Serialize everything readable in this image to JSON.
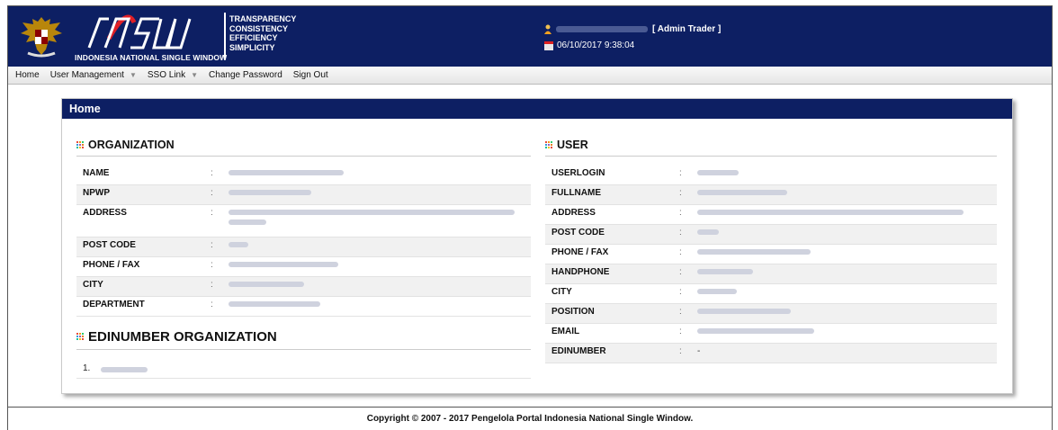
{
  "header": {
    "insw_subtitle": "INDONESIA NATIONAL SINGLE WINDOW",
    "slogan": [
      "TRANSPARENCY",
      "CONSISTENCY",
      "EFFICIENCY",
      "SIMPLICITY"
    ],
    "role": "[ Admin Trader ]",
    "datetime": "06/10/2017 9:38:04",
    "brand_color": "#0d1f63"
  },
  "menu": {
    "items": [
      {
        "label": "Home",
        "has_caret": false
      },
      {
        "label": "User Management",
        "has_caret": true
      },
      {
        "label": "SSO Link",
        "has_caret": true
      },
      {
        "label": "Change Password",
        "has_caret": false
      },
      {
        "label": "Sign Out",
        "has_caret": false
      }
    ]
  },
  "panel": {
    "title": "Home",
    "organization": {
      "title": "ORGANIZATION",
      "fields": [
        {
          "label": "NAME",
          "value": ""
        },
        {
          "label": "NPWP",
          "value": ""
        },
        {
          "label": "ADDRESS",
          "value": ""
        },
        {
          "label": "POST CODE",
          "value": ""
        },
        {
          "label": "PHONE / FAX",
          "value": ""
        },
        {
          "label": "CITY",
          "value": ""
        },
        {
          "label": "DEPARTMENT",
          "value": ""
        }
      ]
    },
    "edinumber": {
      "title": "EDINUMBER ORGANIZATION",
      "items": [
        {
          "index": "1.",
          "value": ""
        }
      ]
    },
    "user": {
      "title": "USER",
      "fields": [
        {
          "label": "USERLOGIN",
          "value": ""
        },
        {
          "label": "FULLNAME",
          "value": ""
        },
        {
          "label": "ADDRESS",
          "value": ""
        },
        {
          "label": "POST CODE",
          "value": ""
        },
        {
          "label": "PHONE / FAX",
          "value": ""
        },
        {
          "label": "HANDPHONE",
          "value": ""
        },
        {
          "label": "CITY",
          "value": ""
        },
        {
          "label": "POSITION",
          "value": ""
        },
        {
          "label": "EMAIL",
          "value": ""
        },
        {
          "label": "EDINUMBER",
          "value": "-"
        }
      ]
    }
  },
  "footer": {
    "copyright": "Copyright © 2007 - 2017 Pengelola Portal Indonesia National Single Window."
  }
}
